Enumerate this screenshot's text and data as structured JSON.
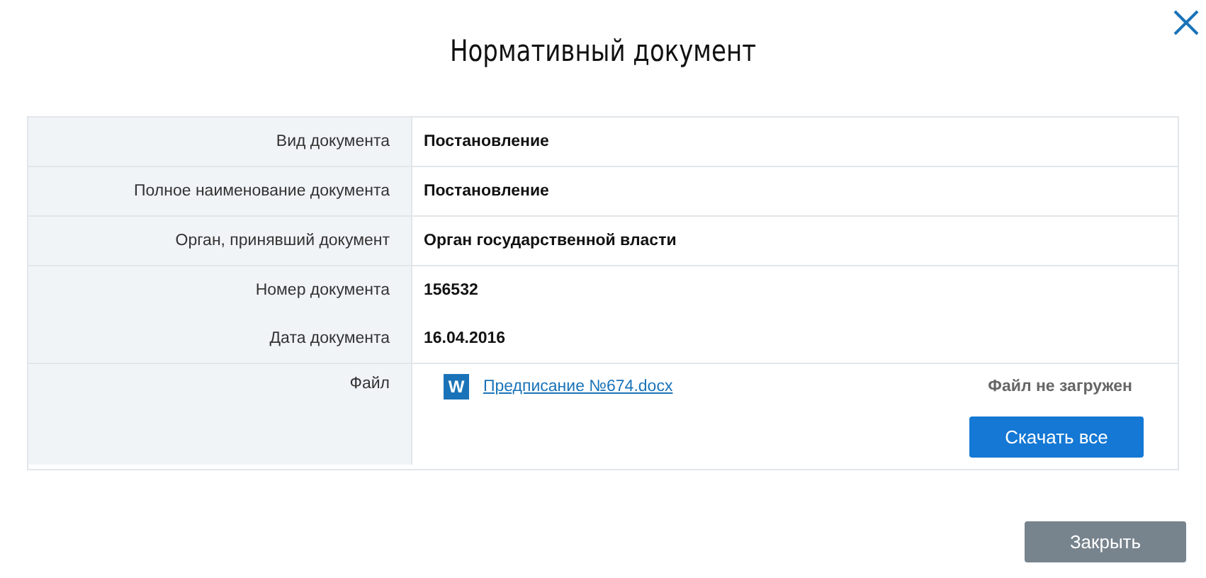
{
  "dialog": {
    "title": "Нормативный документ"
  },
  "field_groups": [
    [
      {
        "label": "Вид документа",
        "value": "Постановление"
      }
    ],
    [
      {
        "label": "Полное наименование документа",
        "value": "Постановление"
      }
    ],
    [
      {
        "label": "Орган, принявший документ",
        "value": "Орган государственной власти"
      }
    ],
    [
      {
        "label": "Номер документа",
        "value": "156532"
      },
      {
        "label": "Дата документа",
        "value": "16.04.2016"
      }
    ]
  ],
  "file": {
    "label": "Файл",
    "icon_letter": "W",
    "name": "Предписание №674.docx",
    "status": "Файл не загружен",
    "download_all": "Скачать все"
  },
  "buttons": [
    "Закрыть"
  ]
}
